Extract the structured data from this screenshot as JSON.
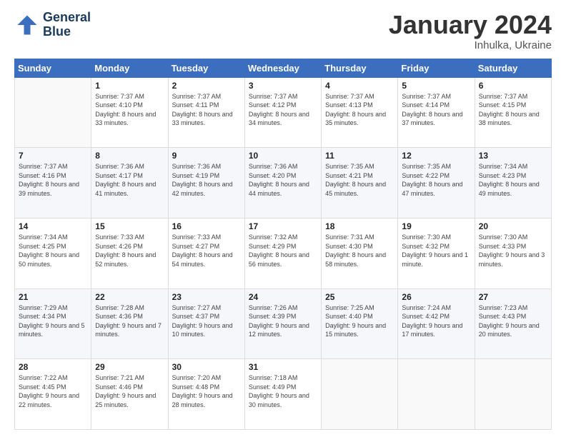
{
  "logo": {
    "line1": "General",
    "line2": "Blue"
  },
  "header": {
    "title": "January 2024",
    "subtitle": "Inhulka, Ukraine"
  },
  "weekdays": [
    "Sunday",
    "Monday",
    "Tuesday",
    "Wednesday",
    "Thursday",
    "Friday",
    "Saturday"
  ],
  "weeks": [
    [
      {
        "day": "",
        "sunrise": "",
        "sunset": "",
        "daylight": ""
      },
      {
        "day": "1",
        "sunrise": "Sunrise: 7:37 AM",
        "sunset": "Sunset: 4:10 PM",
        "daylight": "Daylight: 8 hours and 33 minutes."
      },
      {
        "day": "2",
        "sunrise": "Sunrise: 7:37 AM",
        "sunset": "Sunset: 4:11 PM",
        "daylight": "Daylight: 8 hours and 33 minutes."
      },
      {
        "day": "3",
        "sunrise": "Sunrise: 7:37 AM",
        "sunset": "Sunset: 4:12 PM",
        "daylight": "Daylight: 8 hours and 34 minutes."
      },
      {
        "day": "4",
        "sunrise": "Sunrise: 7:37 AM",
        "sunset": "Sunset: 4:13 PM",
        "daylight": "Daylight: 8 hours and 35 minutes."
      },
      {
        "day": "5",
        "sunrise": "Sunrise: 7:37 AM",
        "sunset": "Sunset: 4:14 PM",
        "daylight": "Daylight: 8 hours and 37 minutes."
      },
      {
        "day": "6",
        "sunrise": "Sunrise: 7:37 AM",
        "sunset": "Sunset: 4:15 PM",
        "daylight": "Daylight: 8 hours and 38 minutes."
      }
    ],
    [
      {
        "day": "7",
        "sunrise": "Sunrise: 7:37 AM",
        "sunset": "Sunset: 4:16 PM",
        "daylight": "Daylight: 8 hours and 39 minutes."
      },
      {
        "day": "8",
        "sunrise": "Sunrise: 7:36 AM",
        "sunset": "Sunset: 4:17 PM",
        "daylight": "Daylight: 8 hours and 41 minutes."
      },
      {
        "day": "9",
        "sunrise": "Sunrise: 7:36 AM",
        "sunset": "Sunset: 4:19 PM",
        "daylight": "Daylight: 8 hours and 42 minutes."
      },
      {
        "day": "10",
        "sunrise": "Sunrise: 7:36 AM",
        "sunset": "Sunset: 4:20 PM",
        "daylight": "Daylight: 8 hours and 44 minutes."
      },
      {
        "day": "11",
        "sunrise": "Sunrise: 7:35 AM",
        "sunset": "Sunset: 4:21 PM",
        "daylight": "Daylight: 8 hours and 45 minutes."
      },
      {
        "day": "12",
        "sunrise": "Sunrise: 7:35 AM",
        "sunset": "Sunset: 4:22 PM",
        "daylight": "Daylight: 8 hours and 47 minutes."
      },
      {
        "day": "13",
        "sunrise": "Sunrise: 7:34 AM",
        "sunset": "Sunset: 4:23 PM",
        "daylight": "Daylight: 8 hours and 49 minutes."
      }
    ],
    [
      {
        "day": "14",
        "sunrise": "Sunrise: 7:34 AM",
        "sunset": "Sunset: 4:25 PM",
        "daylight": "Daylight: 8 hours and 50 minutes."
      },
      {
        "day": "15",
        "sunrise": "Sunrise: 7:33 AM",
        "sunset": "Sunset: 4:26 PM",
        "daylight": "Daylight: 8 hours and 52 minutes."
      },
      {
        "day": "16",
        "sunrise": "Sunrise: 7:33 AM",
        "sunset": "Sunset: 4:27 PM",
        "daylight": "Daylight: 8 hours and 54 minutes."
      },
      {
        "day": "17",
        "sunrise": "Sunrise: 7:32 AM",
        "sunset": "Sunset: 4:29 PM",
        "daylight": "Daylight: 8 hours and 56 minutes."
      },
      {
        "day": "18",
        "sunrise": "Sunrise: 7:31 AM",
        "sunset": "Sunset: 4:30 PM",
        "daylight": "Daylight: 8 hours and 58 minutes."
      },
      {
        "day": "19",
        "sunrise": "Sunrise: 7:30 AM",
        "sunset": "Sunset: 4:32 PM",
        "daylight": "Daylight: 9 hours and 1 minute."
      },
      {
        "day": "20",
        "sunrise": "Sunrise: 7:30 AM",
        "sunset": "Sunset: 4:33 PM",
        "daylight": "Daylight: 9 hours and 3 minutes."
      }
    ],
    [
      {
        "day": "21",
        "sunrise": "Sunrise: 7:29 AM",
        "sunset": "Sunset: 4:34 PM",
        "daylight": "Daylight: 9 hours and 5 minutes."
      },
      {
        "day": "22",
        "sunrise": "Sunrise: 7:28 AM",
        "sunset": "Sunset: 4:36 PM",
        "daylight": "Daylight: 9 hours and 7 minutes."
      },
      {
        "day": "23",
        "sunrise": "Sunrise: 7:27 AM",
        "sunset": "Sunset: 4:37 PM",
        "daylight": "Daylight: 9 hours and 10 minutes."
      },
      {
        "day": "24",
        "sunrise": "Sunrise: 7:26 AM",
        "sunset": "Sunset: 4:39 PM",
        "daylight": "Daylight: 9 hours and 12 minutes."
      },
      {
        "day": "25",
        "sunrise": "Sunrise: 7:25 AM",
        "sunset": "Sunset: 4:40 PM",
        "daylight": "Daylight: 9 hours and 15 minutes."
      },
      {
        "day": "26",
        "sunrise": "Sunrise: 7:24 AM",
        "sunset": "Sunset: 4:42 PM",
        "daylight": "Daylight: 9 hours and 17 minutes."
      },
      {
        "day": "27",
        "sunrise": "Sunrise: 7:23 AM",
        "sunset": "Sunset: 4:43 PM",
        "daylight": "Daylight: 9 hours and 20 minutes."
      }
    ],
    [
      {
        "day": "28",
        "sunrise": "Sunrise: 7:22 AM",
        "sunset": "Sunset: 4:45 PM",
        "daylight": "Daylight: 9 hours and 22 minutes."
      },
      {
        "day": "29",
        "sunrise": "Sunrise: 7:21 AM",
        "sunset": "Sunset: 4:46 PM",
        "daylight": "Daylight: 9 hours and 25 minutes."
      },
      {
        "day": "30",
        "sunrise": "Sunrise: 7:20 AM",
        "sunset": "Sunset: 4:48 PM",
        "daylight": "Daylight: 9 hours and 28 minutes."
      },
      {
        "day": "31",
        "sunrise": "Sunrise: 7:18 AM",
        "sunset": "Sunset: 4:49 PM",
        "daylight": "Daylight: 9 hours and 30 minutes."
      },
      {
        "day": "",
        "sunrise": "",
        "sunset": "",
        "daylight": ""
      },
      {
        "day": "",
        "sunrise": "",
        "sunset": "",
        "daylight": ""
      },
      {
        "day": "",
        "sunrise": "",
        "sunset": "",
        "daylight": ""
      }
    ]
  ]
}
